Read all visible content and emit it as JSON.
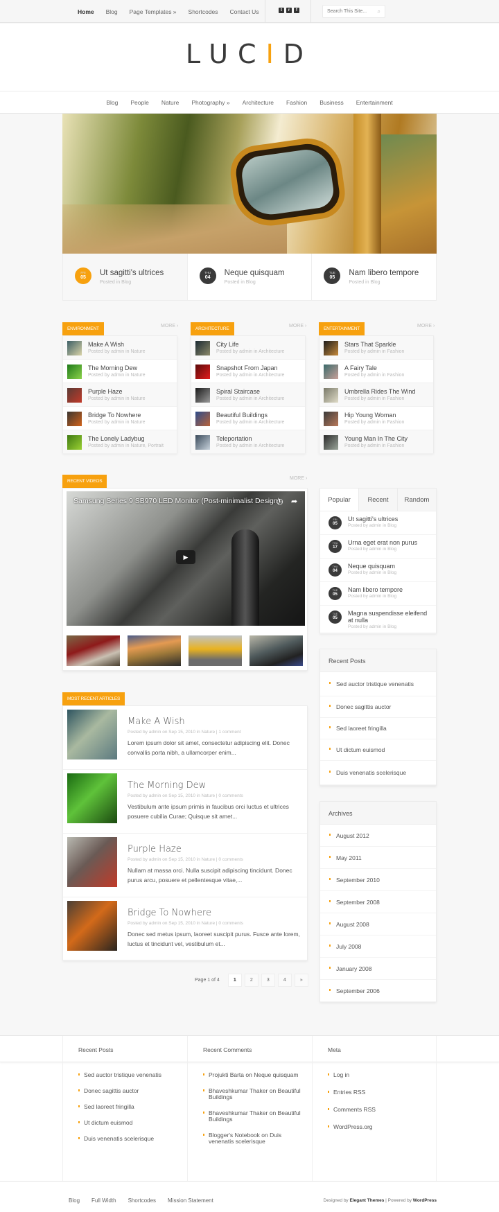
{
  "topbar": {
    "nav": [
      "Home",
      "Blog",
      "Page Templates »",
      "Shortcodes",
      "Contact Us"
    ],
    "active": "Home",
    "social": [
      {
        "icon": "twitter-icon",
        "glyph": "t"
      },
      {
        "icon": "rss-icon",
        "glyph": "r"
      },
      {
        "icon": "facebook-icon",
        "glyph": "f"
      }
    ],
    "search_placeholder": "Search This Site...",
    "search_icon": "magnifier-icon"
  },
  "logo": {
    "before": "LUC",
    "accent": "I",
    "after": "D",
    "accent_color": "#f7a10f"
  },
  "category_nav": [
    "Blog",
    "People",
    "Nature",
    "Photography »",
    "Architecture",
    "Fashion",
    "Business",
    "Entertainment"
  ],
  "featured": [
    {
      "day": "FRI",
      "date": "05",
      "title": "Ut sagitti's ultrices",
      "sub": "Posted in Blog",
      "active": true
    },
    {
      "day": "THU",
      "date": "04",
      "title": "Neque quisquam",
      "sub": "Posted in Blog"
    },
    {
      "day": "TUE",
      "date": "05",
      "title": "Nam libero tempore",
      "sub": "Posted in Blog"
    }
  ],
  "more_label": "MORE ›",
  "categories": [
    {
      "label": "Environment",
      "items": [
        {
          "title": "Make A Wish",
          "sub": "Posted by admin in Nature"
        },
        {
          "title": "The Morning Dew",
          "sub": "Posted by admin in Nature"
        },
        {
          "title": "Purple Haze",
          "sub": "Posted by admin in Nature"
        },
        {
          "title": "Bridge To Nowhere",
          "sub": "Posted by admin in Nature"
        },
        {
          "title": "The Lonely Ladybug",
          "sub": "Posted by admin in Nature, Portrait"
        }
      ]
    },
    {
      "label": "Architecture",
      "items": [
        {
          "title": "City Life",
          "sub": "Posted by admin in Architecture"
        },
        {
          "title": "Snapshot From Japan",
          "sub": "Posted by admin in Architecture"
        },
        {
          "title": "Spiral Staircase",
          "sub": "Posted by admin in Architecture"
        },
        {
          "title": "Beautiful Buildings",
          "sub": "Posted by admin in Architecture"
        },
        {
          "title": "Teleportation",
          "sub": "Posted by admin in Architecture"
        }
      ]
    },
    {
      "label": "Entertainment",
      "items": [
        {
          "title": "Stars That Sparkle",
          "sub": "Posted by admin in Fashion"
        },
        {
          "title": "A Fairy Tale",
          "sub": "Posted by admin in Fashion"
        },
        {
          "title": "Umbrella Rides The Wind",
          "sub": "Posted by admin in Fashion"
        },
        {
          "title": "Hip Young Woman",
          "sub": "Posted by admin in Fashion"
        },
        {
          "title": "Young Man In The City",
          "sub": "Posted by admin in Fashion"
        }
      ]
    }
  ],
  "videos": {
    "label": "Recent Videos",
    "title": "Samsung Series 9 SB970 LED Monitor (Post-minimalist Design)",
    "play": "▶",
    "watch_later_icon": "◷",
    "share_icon": "➦"
  },
  "tabs_widget": {
    "tabs": [
      "Popular",
      "Recent",
      "Random"
    ],
    "active": "Popular",
    "items": [
      {
        "day": "FRI",
        "date": "05",
        "title": "Ut sagitti's ultrices",
        "sub": "Posted by admin in Blog"
      },
      {
        "day": "THU",
        "date": "17",
        "title": "Urna eget erat non purus",
        "sub": "Posted by admin in Blog"
      },
      {
        "day": "THU",
        "date": "04",
        "title": "Neque quisquam",
        "sub": "Posted by admin in Blog"
      },
      {
        "day": "TUE",
        "date": "05",
        "title": "Nam libero tempore",
        "sub": "Posted by admin in Blog"
      },
      {
        "day": "TUE",
        "date": "05",
        "title": "Magna suspendisse eleifend at nulla",
        "sub": "Posted by admin in Blog"
      }
    ]
  },
  "recent_posts": {
    "title": "Recent Posts",
    "items": [
      "Sed auctor tristique venenatis",
      "Donec sagittis auctor",
      "Sed laoreet fringilla",
      "Ut dictum euismod",
      "Duis venenatis scelerisque"
    ]
  },
  "archives": {
    "title": "Archives",
    "items": [
      "August 2012",
      "May 2011",
      "September 2010",
      "September 2008",
      "August 2008",
      "July 2008",
      "January 2008",
      "September 2006"
    ]
  },
  "articles": {
    "label": "Most Recent Articles",
    "items": [
      {
        "title": "Make A Wish",
        "meta": "Posted by admin on Sep 15, 2010 in Nature | 1 comment",
        "excerpt": "Lorem ipsum dolor sit amet, consectetur adipiscing elit. Donec convallis porta nibh, a ullamcorper enim..."
      },
      {
        "title": "The Morning Dew",
        "meta": "Posted by admin on Sep 15, 2010 in Nature | 0 comments",
        "excerpt": "Vestibulum ante ipsum primis in faucibus orci luctus et ultrices posuere cubilia Curae; Quisque sit amet..."
      },
      {
        "title": "Purple Haze",
        "meta": "Posted by admin on Sep 15, 2010 in Nature | 0 comments",
        "excerpt": "Nullam at massa orci. Nulla suscipit adipiscing tincidunt. Donec purus arcu, posuere et pellentesque vitae,..."
      },
      {
        "title": "Bridge To Nowhere",
        "meta": "Posted by admin on Sep 15, 2010 in Nature | 0 comments",
        "excerpt": "Donec sed metus ipsum, laoreet suscipit purus. Fusce ante lorem, luctus et tincidunt vel, vestibulum et..."
      }
    ]
  },
  "pagination": {
    "label": "Page 1 of 4",
    "pages": [
      "1",
      "2",
      "3",
      "4",
      "»"
    ],
    "current": "1"
  },
  "footer": {
    "recent_posts": {
      "title": "Recent Posts",
      "items": [
        "Sed auctor tristique venenatis",
        "Donec sagittis auctor",
        "Sed laoreet fringilla",
        "Ut dictum euismod",
        "Duis venenatis scelerisque"
      ]
    },
    "recent_comments": {
      "title": "Recent Comments",
      "items": [
        "Projukti Barta on Neque quisquam",
        "Bhaveshkumar Thaker on Beautiful Buildings",
        "Bhaveshkumar Thaker on Beautiful Buildings",
        "Blogger's Notebook on Duis venenatis scelerisque"
      ]
    },
    "meta": {
      "title": "Meta",
      "items": [
        "Log in",
        "Entries RSS",
        "Comments RSS",
        "WordPress.org"
      ]
    }
  },
  "bottom": {
    "nav": [
      "Blog",
      "Full Width",
      "Shortcodes",
      "Mission Statement"
    ],
    "credit_prefix": "Designed by ",
    "credit_designer": "Elegant Themes",
    "credit_mid": " | Powered by ",
    "credit_platform": "WordPress"
  }
}
